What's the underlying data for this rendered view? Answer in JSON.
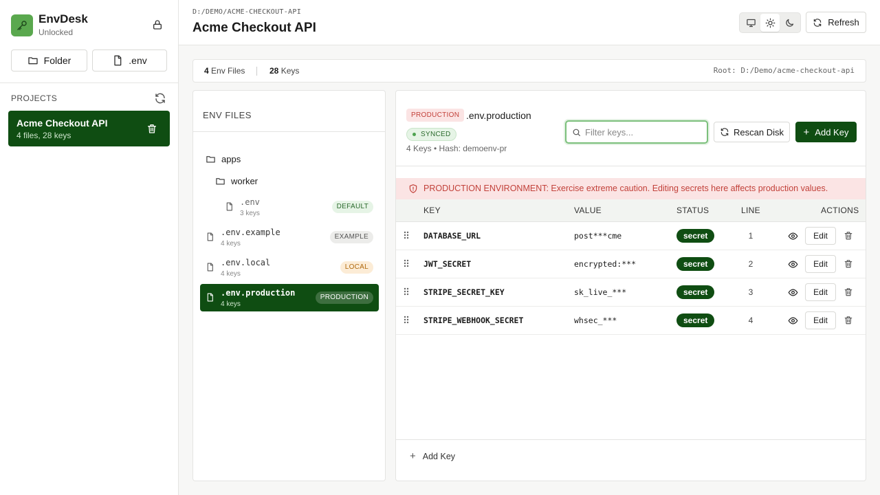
{
  "brand": {
    "name": "EnvDesk",
    "status": "Unlocked"
  },
  "sidebar": {
    "folder_label": "Folder",
    "env_label": ".env",
    "projects_label": "PROJECTS",
    "projects": [
      {
        "name": "Acme Checkout API",
        "meta": "4 files, 28 keys"
      }
    ]
  },
  "header": {
    "breadcrumb": "D:/DEMO/ACME-CHECKOUT-API",
    "title": "Acme Checkout API",
    "refresh_label": "Refresh"
  },
  "stats": {
    "env_files_count": "4",
    "env_files_label": "Env Files",
    "keys_count": "28",
    "keys_label": "Keys",
    "root": "Root: D:/Demo/acme-checkout-api"
  },
  "files_panel": {
    "title": "ENV FILES",
    "folders": [
      {
        "name": "apps"
      },
      {
        "name": "worker"
      }
    ],
    "files": [
      {
        "name": ".env",
        "keys": "3 keys",
        "badge": "DEFAULT"
      },
      {
        "name": ".env.example",
        "keys": "4 keys",
        "badge": "EXAMPLE"
      },
      {
        "name": ".env.local",
        "keys": "4 keys",
        "badge": "LOCAL"
      },
      {
        "name": ".env.production",
        "keys": "4 keys",
        "badge": "PRODUCTION"
      }
    ]
  },
  "main": {
    "env_badge": "PRODUCTION",
    "env_name": ".env.production",
    "synced": "SYNCED",
    "meta": "4 Keys • Hash: demoenv-pr",
    "filter_placeholder": "Filter keys...",
    "rescan_label": "Rescan Disk",
    "add_key_label": "Add Key",
    "warning": "PRODUCTION ENVIRONMENT: Exercise extreme caution. Editing secrets here affects production values.",
    "columns": {
      "key": "KEY",
      "value": "VALUE",
      "status": "STATUS",
      "line": "LINE",
      "actions": "ACTIONS"
    },
    "rows": [
      {
        "key": "DATABASE_URL",
        "value": "post***cme",
        "status": "secret",
        "line": "1",
        "edit": "Edit"
      },
      {
        "key": "JWT_SECRET",
        "value": "encrypted:***",
        "status": "secret",
        "line": "2",
        "edit": "Edit"
      },
      {
        "key": "STRIPE_SECRET_KEY",
        "value": "sk_live_***",
        "status": "secret",
        "line": "3",
        "edit": "Edit"
      },
      {
        "key": "STRIPE_WEBHOOK_SECRET",
        "value": "whsec_***",
        "status": "secret",
        "line": "4",
        "edit": "Edit"
      }
    ],
    "footer_add_label": "Add Key"
  },
  "colors": {
    "accent_dark_green": "#0f4d12",
    "logo_green": "#5aa84e",
    "danger_red": "#c2413a",
    "danger_bg": "#fbe4e4"
  }
}
